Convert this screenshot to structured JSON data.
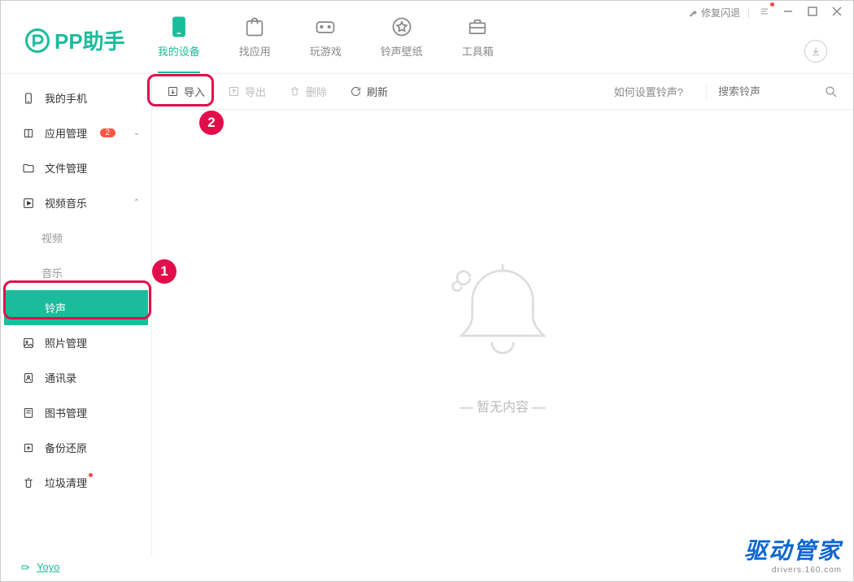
{
  "titlebar": {
    "fix": "修复闪退"
  },
  "logo": {
    "text": "PP助手"
  },
  "tabs": [
    {
      "label": "我的设备"
    },
    {
      "label": "找应用"
    },
    {
      "label": "玩游戏"
    },
    {
      "label": "铃声壁纸"
    },
    {
      "label": "工具箱"
    }
  ],
  "sidebar": {
    "my_phone": "我的手机",
    "app_mgmt": "应用管理",
    "app_badge": "2",
    "file_mgmt": "文件管理",
    "video_music": "视频音乐",
    "video": "视频",
    "music": "音乐",
    "ringtone": "铃声",
    "photo_mgmt": "照片管理",
    "contacts": "通讯录",
    "book_mgmt": "图书管理",
    "backup": "备份还原",
    "trash": "垃圾清理"
  },
  "footer": {
    "device": "Yoyo"
  },
  "toolbar": {
    "import": "导入",
    "export": "导出",
    "delete": "删除",
    "refresh": "刷新",
    "help": "如何设置铃声?",
    "search_ph": "搜索铃声"
  },
  "empty": {
    "text": "— 暂无内容 —"
  },
  "annotations": {
    "one": "1",
    "two": "2"
  },
  "watermark": {
    "big": "驱动管家",
    "small": "drivers.160.com"
  }
}
